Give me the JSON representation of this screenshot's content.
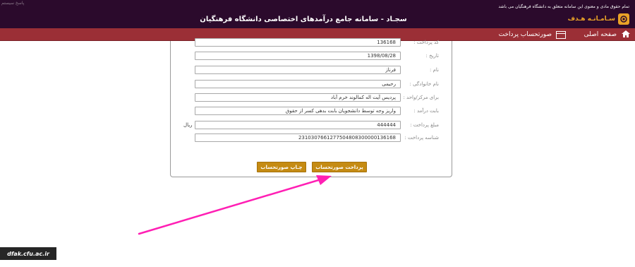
{
  "header": {
    "corner_text": "پاسخ سیستم",
    "copyright": "تمام حقوق مادی و معنوی این سامانه متعلق به دانشگاه فرهنگیان می باشد",
    "system_title": "سجـاد - سامانه جامع درآمدهای اختصاصی دانشگاه فرهنگیان",
    "logo_text": "سـامـانـه هـدف"
  },
  "nav": {
    "home_label": "صفحه اصلی",
    "invoice_label": "صورتحساب پرداخت"
  },
  "form": {
    "fields": [
      {
        "label": "کد پرداخت :",
        "value": "136168"
      },
      {
        "label": "تاریخ :",
        "value": "1398/08/28"
      },
      {
        "label": "نام :",
        "value": "فرناز"
      },
      {
        "label": "نام خانوادگی :",
        "value": "رحیمی"
      },
      {
        "label": "برای مرکز/واحد :",
        "value": "پردیس آیت اله کمالوند خرم آباد"
      },
      {
        "label": "بابت درآمد :",
        "value": "واریز وجه توسط دانشجویان بابت بدهی کسر از حقوق"
      },
      {
        "label": "مبلغ پرداخت :",
        "value": "444444"
      },
      {
        "label": "شناسه پرداخت :",
        "value": "2310307661277504808300000136168"
      }
    ],
    "currency": "ریال",
    "pay_button": "پرداخت صورتحساب",
    "print_button": "چـاپ صورتحساب"
  },
  "watermark": "dfak.cfu.ac.ir",
  "colors": {
    "header_bg": "#2b0a2c",
    "nav_bg": "#9b2f36",
    "button_bg": "#c58b13",
    "arrow": "#ff1fb4"
  }
}
